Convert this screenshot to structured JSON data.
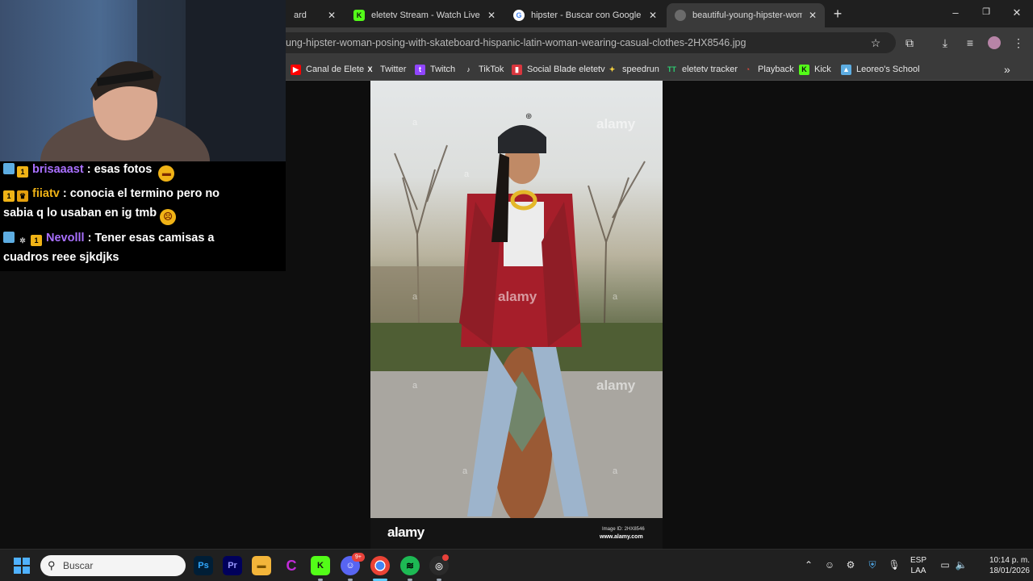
{
  "browser": {
    "tabs": [
      {
        "title": "ard",
        "active": false
      },
      {
        "title": "eletetv Stream - Watch Live on",
        "active": false,
        "favicon": "kick-icon"
      },
      {
        "title": "hipster - Buscar con Google",
        "active": false,
        "favicon": "google-icon"
      },
      {
        "title": "beautiful-young-hipster-woman",
        "active": true,
        "favicon": "globe-icon"
      }
    ],
    "url": "ung-hipster-woman-posing-with-skateboard-hispanic-latin-woman-wearing-casual-clothes-2HX8546.jpg",
    "bookmarks": [
      {
        "label": "Canal de Elete",
        "icon": "youtube-icon",
        "color": "#ff0000"
      },
      {
        "label": "Twitter",
        "icon": "x-icon",
        "color": "#ffffff"
      },
      {
        "label": "Twitch",
        "icon": "twitch-icon",
        "color": "#9146ff"
      },
      {
        "label": "TikTok",
        "icon": "tiktok-icon",
        "color": "#ffffff"
      },
      {
        "label": "Social Blade eletetv",
        "icon": "socialblade-icon",
        "color": "#d9363e"
      },
      {
        "label": "speedrun",
        "icon": "speedrun-icon",
        "color": "#f4d03f"
      },
      {
        "label": "eletetv tracker",
        "icon": "tracker-icon",
        "color": "#2ecc71"
      },
      {
        "label": "Playback",
        "icon": "playback-icon",
        "color": "#e74c3c"
      },
      {
        "label": "Kick",
        "icon": "kick-icon",
        "color": "#53fc18"
      },
      {
        "label": "Leoreo's School",
        "icon": "school-icon",
        "color": "#5dade2"
      }
    ]
  },
  "image": {
    "logo": "alamy",
    "image_id": "Image ID: 2HX8546",
    "site": "www.alamy.com"
  },
  "chat": {
    "messages": [
      {
        "user": "brisaaast",
        "user_color": "#a970ff",
        "text": ": esas fotos"
      },
      {
        "user": "fiiatv",
        "user_color": "#f0b316",
        "text": ": conocia el termino pero no",
        "text2": "sabia q lo usaban en ig tmb"
      },
      {
        "user": "Nevolll",
        "user_color": "#a970ff",
        "text": ": Tener esas camisas a",
        "text2": "cuadros reee sjkdjks"
      }
    ]
  },
  "taskbar": {
    "search_placeholder": "Buscar",
    "language": "ESP",
    "language_sub": "LAA",
    "time": "10:14 p. m.",
    "date": "18/01/2026",
    "apps": [
      "photoshop-icon",
      "premiere-icon",
      "file-explorer-icon",
      "canva-icon",
      "kick-icon",
      "discord-icon",
      "chrome-icon",
      "spotify-icon",
      "obs-icon"
    ],
    "discord_badge": "9+"
  }
}
